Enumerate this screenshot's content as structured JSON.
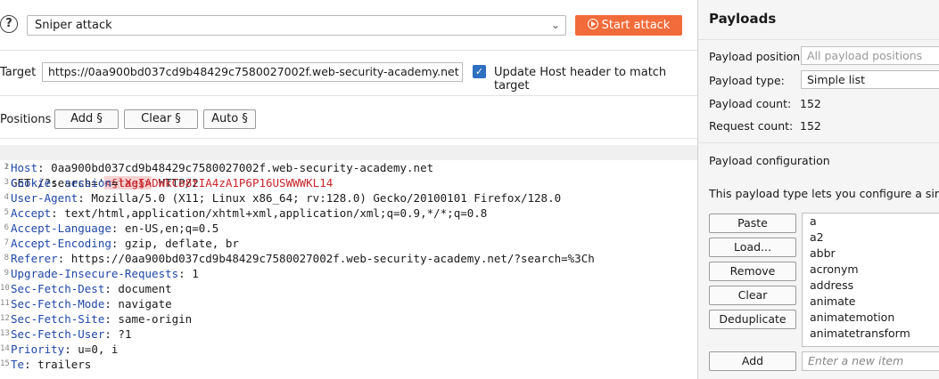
{
  "toolbar": {
    "attack_type": "Sniper attack",
    "start_attack_label": "Start attack"
  },
  "target": {
    "label": "Target",
    "url": "https://0aa900bd037cd9b48429c7580027002f.web-security-academy.net",
    "update_host_checked": true,
    "update_host_label": "Update Host header to match target"
  },
  "positions": {
    "label": "Positions",
    "add_label": "Add §",
    "clear_label": "Clear §",
    "auto_label": "Auto §"
  },
  "request": {
    "line1_pre": "GET /?search='",
    "line1_payload": "<§tag§>",
    "line1_post": " HTTP/2",
    "lines": [
      {
        "n": "2",
        "name": "Host",
        "value": "0aa900bd037cd9b48429c7580027002f.web-security-academy.net"
      },
      {
        "n": "3",
        "name": "Cookie",
        "cookie_name": "session",
        "cookie_value": "lXeIADWkCo8tIA4zA1P6P16USWWWKL14"
      },
      {
        "n": "4",
        "name": "User-Agent",
        "value": "Mozilla/5.0 (X11; Linux x86_64; rv:128.0) Gecko/20100101 Firefox/128.0"
      },
      {
        "n": "5",
        "name": "Accept",
        "value": "text/html,application/xhtml+xml,application/xml;q=0.9,*/*;q=0.8"
      },
      {
        "n": "6",
        "name": "Accept-Language",
        "value": "en-US,en;q=0.5"
      },
      {
        "n": "7",
        "name": "Accept-Encoding",
        "value": "gzip, deflate, br"
      },
      {
        "n": "8",
        "name": "Referer",
        "value": "https://0aa900bd037cd9b48429c7580027002f.web-security-academy.net/?search=%3Ch"
      },
      {
        "n": "9",
        "name": "Upgrade-Insecure-Requests",
        "value": "1"
      },
      {
        "n": "10",
        "name": "Sec-Fetch-Dest",
        "value": "document"
      },
      {
        "n": "11",
        "name": "Sec-Fetch-Mode",
        "value": "navigate"
      },
      {
        "n": "12",
        "name": "Sec-Fetch-Site",
        "value": "same-origin"
      },
      {
        "n": "13",
        "name": "Sec-Fetch-User",
        "value": "?1"
      },
      {
        "n": "14",
        "name": "Priority",
        "value": "u=0, i"
      },
      {
        "n": "15",
        "name": "Te",
        "value": "trailers"
      }
    ]
  },
  "payloads": {
    "title": "Payloads",
    "position_label": "Payload position:",
    "position_value": "All payload positions",
    "type_label": "Payload type:",
    "type_value": "Simple list",
    "count_label": "Payload count:",
    "count_value": "152",
    "request_count_label": "Request count:",
    "request_count_value": "152",
    "config_title": "Payload configuration",
    "config_desc": "This payload type lets you configure a simple",
    "buttons": {
      "paste": "Paste",
      "load": "Load...",
      "remove": "Remove",
      "clear": "Clear",
      "deduplicate": "Deduplicate",
      "add": "Add"
    },
    "list": [
      "a",
      "a2",
      "abbr",
      "acronym",
      "address",
      "animate",
      "animatemotion",
      "animatetransform"
    ],
    "new_item_placeholder": "Enter a new item"
  },
  "colors": {
    "accent": "#f26b3a",
    "checkbox": "#2f6fc0",
    "header_name": "#1f47a8",
    "cookie_value": "#c8242a"
  }
}
